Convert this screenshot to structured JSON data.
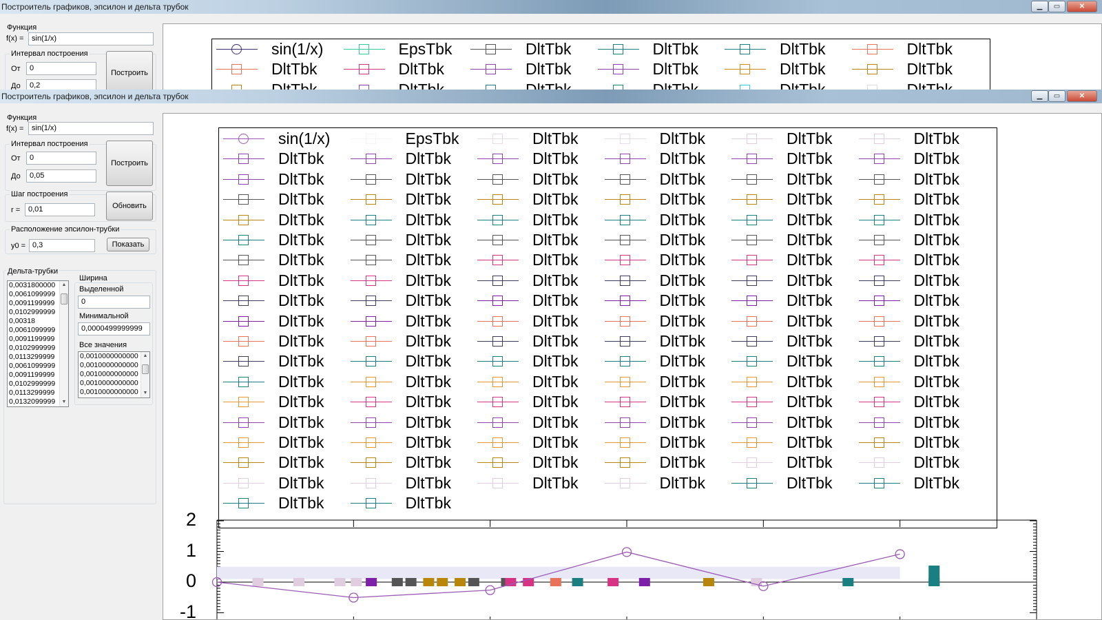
{
  "window": {
    "title": "Построитель графиков, эпсилон и дельта трубок",
    "controls": {
      "minimize": "▁",
      "maximize": "▭",
      "close": "✕"
    }
  },
  "form": {
    "function_group": "Функция",
    "fx_label": "f(x) =",
    "fx_value": "sin(1/x)",
    "interval_group": "Интервал построения",
    "from_label": "От",
    "from_value": "0",
    "to_label": "До",
    "to_value_back": "0,2",
    "to_value": "0,05",
    "build_button": "Построить",
    "step_group": "Шаг построения",
    "r_label": "r =",
    "r_value": "0,01",
    "update_button": "Обновить",
    "epsilon_group": "Расположение эпсилон-трубки",
    "y0_label": "y0 =",
    "y0_value": "0,3",
    "show_button": "Показать",
    "delta_group": "Дельта-трубки",
    "delta_items": [
      "0,0031800000",
      "0,0061099999",
      "0,0091199999",
      "0,0102999999",
      "0,00318",
      "0,0061099999",
      "0,0091199999",
      "0,0102999999",
      "0,0113299999",
      "0,0061099999",
      "0,0091199999",
      "0,0102999999",
      "0,0113299999",
      "0,0132099999"
    ],
    "width_label": "Ширина",
    "selected_label": "Выделенной",
    "selected_value": "0",
    "minimal_label": "Минимальной",
    "minimal_value": "0,0000499999999",
    "all_values_label": "Все значения",
    "all_values": [
      "0,0010000000000",
      "0,0010000000000",
      "0,0010000000000",
      "0,0010000000000",
      "0,0010000000000"
    ]
  },
  "chart_data": {
    "type": "line",
    "title": "",
    "xlabel": "",
    "ylabel": "",
    "ylim": [
      -1,
      2
    ],
    "yticks": [
      "2",
      "1",
      "0",
      "-1"
    ],
    "grid": false,
    "legend": "top",
    "series": [
      {
        "name": "sin(1/x)",
        "x": [
          0,
          0.01,
          0.02,
          0.03,
          0.04,
          0.05
        ],
        "values": [
          0,
          -0.506,
          -0.262,
          0.981,
          -0.132,
          0.912
        ],
        "color": "#9b59b6",
        "marker": "circle"
      },
      {
        "name": "EpsTbk",
        "color": "#e8e8f6",
        "marker": "none"
      }
    ],
    "delta_tubes_count": 100,
    "delta_tubes_label": "DltTbk"
  },
  "back_legend": {
    "rows": [
      [
        [
          "sin(1/x)",
          "#3b2a6e",
          "circle"
        ],
        [
          "EpsTbk",
          "#2ecc9a",
          "square"
        ],
        [
          "DltTbk",
          "#555555",
          "square"
        ],
        [
          "DltTbk",
          "#1a7f80",
          "square"
        ],
        [
          "DltTbk",
          "#1a7f80",
          "square"
        ],
        [
          "DltTbk",
          "#e8735a",
          "square"
        ]
      ],
      [
        [
          "DltTbk",
          "#e8735a",
          "square"
        ],
        [
          "DltTbk",
          "#d63384",
          "square"
        ],
        [
          "DltTbk",
          "#8e44ad",
          "square"
        ],
        [
          "DltTbk",
          "#8e44ad",
          "square"
        ],
        [
          "DltTbk",
          "#d68910",
          "square"
        ],
        [
          "DltTbk",
          "#b8860b",
          "square"
        ]
      ],
      [
        [
          "DltTbk",
          "#b8860b",
          "square"
        ],
        [
          "DltTbk",
          "#8e44ad",
          "square"
        ],
        [
          "DltTbk",
          "#1a7f80",
          "square"
        ],
        [
          "DltTbk",
          "#1a7f80",
          "square"
        ],
        [
          "DltTbk",
          "#2ecce0",
          "square"
        ],
        [
          "DltTbk",
          "#dddddd",
          "square"
        ]
      ]
    ]
  },
  "legend": {
    "rows": [
      [
        [
          "sin(1/x)",
          "#9b59b6",
          "circle"
        ],
        [
          "EpsTbk",
          "#f4f4fb",
          "square"
        ],
        [
          "DltTbk",
          "#e8dbe8",
          "square"
        ],
        [
          "DltTbk",
          "#e8dbe8",
          "square"
        ],
        [
          "DltTbk",
          "#e0cde0",
          "square"
        ],
        [
          "DltTbk",
          "#e0cde0",
          "square"
        ]
      ],
      [
        [
          "DltTbk",
          "#8e44ad",
          "square"
        ],
        [
          "DltTbk",
          "#8e44ad",
          "square"
        ],
        [
          "DltTbk",
          "#8e44ad",
          "square"
        ],
        [
          "DltTbk",
          "#8e44ad",
          "square"
        ],
        [
          "DltTbk",
          "#8e44ad",
          "square"
        ],
        [
          "DltTbk",
          "#8e44ad",
          "square"
        ]
      ],
      [
        [
          "DltTbk",
          "#8e44ad",
          "square"
        ],
        [
          "DltTbk",
          "#555555",
          "square"
        ],
        [
          "DltTbk",
          "#555555",
          "square"
        ],
        [
          "DltTbk",
          "#555555",
          "square"
        ],
        [
          "DltTbk",
          "#555555",
          "square"
        ],
        [
          "DltTbk",
          "#555555",
          "square"
        ]
      ],
      [
        [
          "DltTbk",
          "#555555",
          "square"
        ],
        [
          "DltTbk",
          "#b8860b",
          "square"
        ],
        [
          "DltTbk",
          "#b8860b",
          "square"
        ],
        [
          "DltTbk",
          "#b8860b",
          "square"
        ],
        [
          "DltTbk",
          "#b8860b",
          "square"
        ],
        [
          "DltTbk",
          "#b8860b",
          "square"
        ]
      ],
      [
        [
          "DltTbk",
          "#b8860b",
          "square"
        ],
        [
          "DltTbk",
          "#1a7f80",
          "square"
        ],
        [
          "DltTbk",
          "#1a7f80",
          "square"
        ],
        [
          "DltTbk",
          "#1a7f80",
          "square"
        ],
        [
          "DltTbk",
          "#1a7f80",
          "square"
        ],
        [
          "DltTbk",
          "#1a7f80",
          "square"
        ]
      ],
      [
        [
          "DltTbk",
          "#1a7f80",
          "square"
        ],
        [
          "DltTbk",
          "#555555",
          "square"
        ],
        [
          "DltTbk",
          "#555555",
          "square"
        ],
        [
          "DltTbk",
          "#555555",
          "square"
        ],
        [
          "DltTbk",
          "#555555",
          "square"
        ],
        [
          "DltTbk",
          "#555555",
          "square"
        ]
      ],
      [
        [
          "DltTbk",
          "#555555",
          "square"
        ],
        [
          "DltTbk",
          "#555555",
          "square"
        ],
        [
          "DltTbk",
          "#d63384",
          "square"
        ],
        [
          "DltTbk",
          "#d63384",
          "square"
        ],
        [
          "DltTbk",
          "#d63384",
          "square"
        ],
        [
          "DltTbk",
          "#d63384",
          "square"
        ]
      ],
      [
        [
          "DltTbk",
          "#d63384",
          "square"
        ],
        [
          "DltTbk",
          "#d63384",
          "square"
        ],
        [
          "DltTbk",
          "#3b3b5e",
          "square"
        ],
        [
          "DltTbk",
          "#3b3b5e",
          "square"
        ],
        [
          "DltTbk",
          "#3b3b5e",
          "square"
        ],
        [
          "DltTbk",
          "#3b3b5e",
          "square"
        ]
      ],
      [
        [
          "DltTbk",
          "#3b3b5e",
          "square"
        ],
        [
          "DltTbk",
          "#3b3b5e",
          "square"
        ],
        [
          "DltTbk",
          "#7d1fa8",
          "square"
        ],
        [
          "DltTbk",
          "#7d1fa8",
          "square"
        ],
        [
          "DltTbk",
          "#7d1fa8",
          "square"
        ],
        [
          "DltTbk",
          "#7d1fa8",
          "square"
        ]
      ],
      [
        [
          "DltTbk",
          "#7d1fa8",
          "square"
        ],
        [
          "DltTbk",
          "#7d1fa8",
          "square"
        ],
        [
          "DltTbk",
          "#e8735a",
          "square"
        ],
        [
          "DltTbk",
          "#e8735a",
          "square"
        ],
        [
          "DltTbk",
          "#e8735a",
          "square"
        ],
        [
          "DltTbk",
          "#e8735a",
          "square"
        ]
      ],
      [
        [
          "DltTbk",
          "#e8735a",
          "square"
        ],
        [
          "DltTbk",
          "#e8735a",
          "square"
        ],
        [
          "DltTbk",
          "#3b3b5e",
          "square"
        ],
        [
          "DltTbk",
          "#3b3b5e",
          "square"
        ],
        [
          "DltTbk",
          "#3b3b5e",
          "square"
        ],
        [
          "DltTbk",
          "#3b3b5e",
          "square"
        ]
      ],
      [
        [
          "DltTbk",
          "#3b3b5e",
          "square"
        ],
        [
          "DltTbk",
          "#1a7f80",
          "square"
        ],
        [
          "DltTbk",
          "#1a7f80",
          "square"
        ],
        [
          "DltTbk",
          "#1a7f80",
          "square"
        ],
        [
          "DltTbk",
          "#1a7f80",
          "square"
        ],
        [
          "DltTbk",
          "#1a7f80",
          "square"
        ]
      ],
      [
        [
          "DltTbk",
          "#1a7f80",
          "square"
        ],
        [
          "DltTbk",
          "#e8962e",
          "square"
        ],
        [
          "DltTbk",
          "#e8962e",
          "square"
        ],
        [
          "DltTbk",
          "#e8962e",
          "square"
        ],
        [
          "DltTbk",
          "#e8962e",
          "square"
        ],
        [
          "DltTbk",
          "#e8962e",
          "square"
        ]
      ],
      [
        [
          "DltTbk",
          "#e8962e",
          "square"
        ],
        [
          "DltTbk",
          "#d63384",
          "square"
        ],
        [
          "DltTbk",
          "#d63384",
          "square"
        ],
        [
          "DltTbk",
          "#d63384",
          "square"
        ],
        [
          "DltTbk",
          "#d63384",
          "square"
        ],
        [
          "DltTbk",
          "#d63384",
          "square"
        ]
      ],
      [
        [
          "DltTbk",
          "#8e44ad",
          "square"
        ],
        [
          "DltTbk",
          "#8e44ad",
          "square"
        ],
        [
          "DltTbk",
          "#8e44ad",
          "square"
        ],
        [
          "DltTbk",
          "#8e44ad",
          "square"
        ],
        [
          "DltTbk",
          "#8e44ad",
          "square"
        ],
        [
          "DltTbk",
          "#8e44ad",
          "square"
        ]
      ],
      [
        [
          "DltTbk",
          "#e8962e",
          "square"
        ],
        [
          "DltTbk",
          "#e8962e",
          "square"
        ],
        [
          "DltTbk",
          "#e8962e",
          "square"
        ],
        [
          "DltTbk",
          "#e8962e",
          "square"
        ],
        [
          "DltTbk",
          "#e8962e",
          "square"
        ],
        [
          "DltTbk",
          "#b8860b",
          "square"
        ]
      ],
      [
        [
          "DltTbk",
          "#b8860b",
          "square"
        ],
        [
          "DltTbk",
          "#b8860b",
          "square"
        ],
        [
          "DltTbk",
          "#b8860b",
          "square"
        ],
        [
          "DltTbk",
          "#b8860b",
          "square"
        ],
        [
          "DltTbk",
          "#e0cde0",
          "square"
        ],
        [
          "DltTbk",
          "#e0cde0",
          "square"
        ]
      ],
      [
        [
          "DltTbk",
          "#e0cde0",
          "square"
        ],
        [
          "DltTbk",
          "#e0cde0",
          "square"
        ],
        [
          "DltTbk",
          "#e0cde0",
          "square"
        ],
        [
          "DltTbk",
          "#e0cde0",
          "square"
        ],
        [
          "DltTbk",
          "#1a7f80",
          "square"
        ],
        [
          "DltTbk",
          "#1a7f80",
          "square"
        ]
      ],
      [
        [
          "DltTbk",
          "#1a7f80",
          "square"
        ],
        [
          "DltTbk",
          "#1a7f80",
          "square"
        ]
      ]
    ]
  }
}
